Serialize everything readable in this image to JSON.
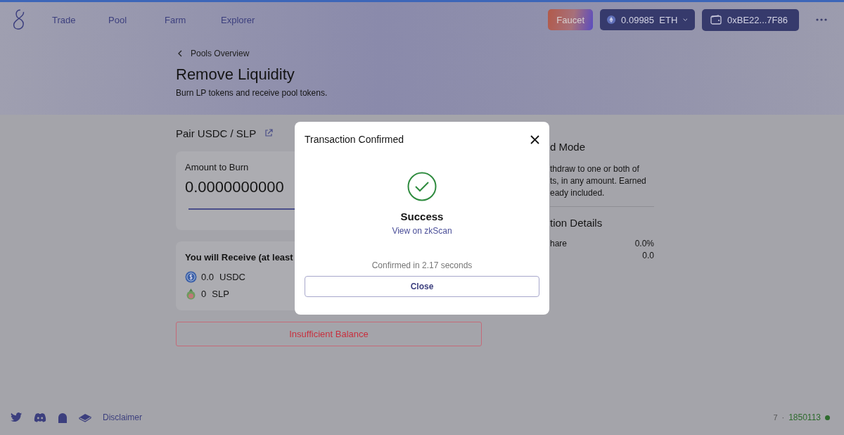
{
  "nav": {
    "items": [
      {
        "label": "Trade"
      },
      {
        "label": "Pool"
      },
      {
        "label": "Farm"
      },
      {
        "label": "Explorer"
      }
    ],
    "faucet": "Faucet",
    "balance": "0.09985  ETH",
    "wallet": "0xBE22...7F86"
  },
  "header": {
    "back": "Pools Overview",
    "title": "Remove Liquidity",
    "subtitle": "Burn LP tokens and receive pool tokens."
  },
  "pair": "Pair USDC / SLP",
  "burn": {
    "label": "Amount to Burn",
    "value": "0.0000000000"
  },
  "receive": {
    "title": "You will Receive (at least",
    "tokens": [
      {
        "kind": "usdc",
        "amount": "0.0",
        "symbol": "USDC"
      },
      {
        "kind": "slp",
        "amount": "0",
        "symbol": "SLP"
      }
    ]
  },
  "submit": "Insufficient Balance",
  "side": {
    "mode_title": "d Mode",
    "mode_text": [
      "thdraw to one or both of",
      "ts, in any amount. Earned",
      "eady included."
    ],
    "details_title": "tion Details",
    "rows": [
      {
        "label": "hare",
        "value": "0.0%"
      },
      {
        "value": "0.0"
      }
    ]
  },
  "modal": {
    "title": "Transaction Confirmed",
    "status": "Success",
    "link": "View on zkScan",
    "note": "Confirmed in 2.17 seconds",
    "button": "Close"
  },
  "footer": {
    "disclaimer": "Disclaimer",
    "version": "7",
    "separator": "·",
    "block": "1850113"
  }
}
